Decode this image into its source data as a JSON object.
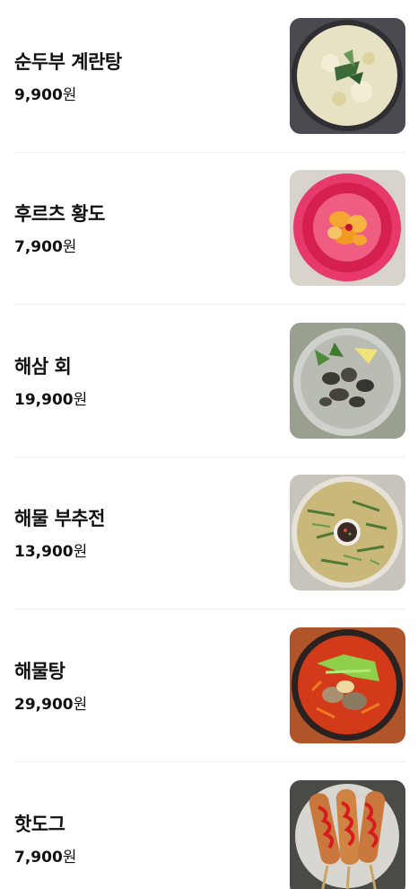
{
  "currency_unit": "원",
  "menu": [
    {
      "name": "순두부 계란탕",
      "price": "9,900",
      "image": "soft-tofu-egg-soup-photo"
    },
    {
      "name": "후르츠 황도",
      "price": "7,900",
      "image": "fruit-peach-dessert-photo"
    },
    {
      "name": "해삼 회",
      "price": "19,900",
      "image": "sea-cucumber-sashimi-photo"
    },
    {
      "name": "해물 부추전",
      "price": "13,900",
      "image": "seafood-chive-pancake-photo"
    },
    {
      "name": "해물탕",
      "price": "29,900",
      "image": "seafood-stew-photo"
    },
    {
      "name": "핫도그",
      "price": "7,900",
      "image": "hotdog-photo"
    }
  ]
}
